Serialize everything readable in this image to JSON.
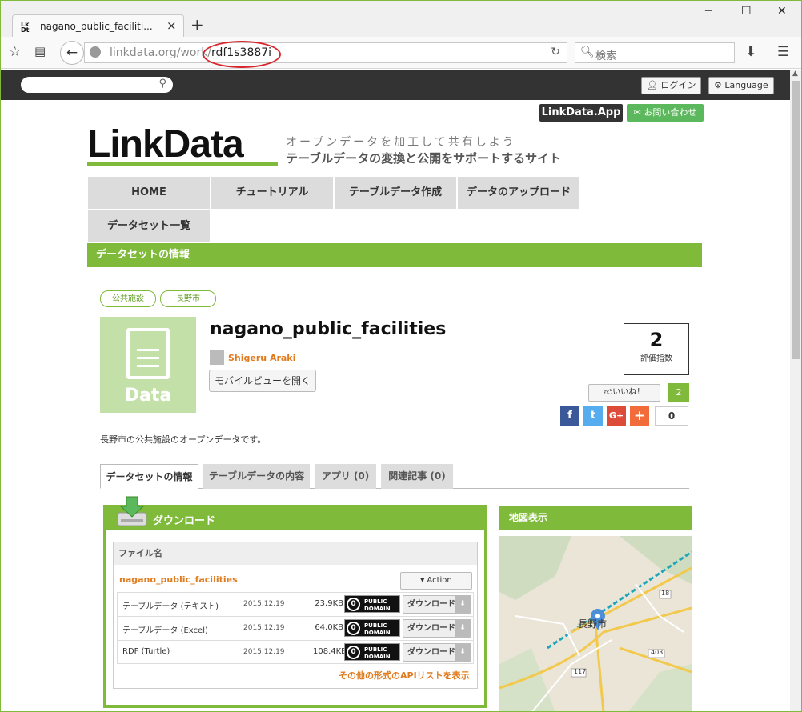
{
  "browser": {
    "tab_title": "nagano_public_faciliti...",
    "tab_favicon": "LinkData",
    "url_host": "linkdata.org/work/",
    "url_path": "rdf1s3887i",
    "search_placeholder": "検索",
    "accent_color": "#7fba3a"
  },
  "topbar": {
    "login_label": "ログイン",
    "language_label": "Language"
  },
  "header": {
    "linkdata_app": "LinkData.App",
    "contact_label": "お問い合わせ",
    "logo_text": "LinkData",
    "tagline1": "オープンデータを加工して共有しよう",
    "tagline2": "テーブルデータの変換と公開をサポートするサイト"
  },
  "menu": {
    "items": [
      "HOME",
      "チュートリアル",
      "テーブルデータ作成",
      "データのアップロード",
      "データセット一覧"
    ]
  },
  "section_title": "データセットの情報",
  "dataset": {
    "tags": [
      "公共施設",
      "長野市"
    ],
    "thumb_label": "Data",
    "title": "nagano_public_facilities",
    "author": "Shigeru Araki",
    "mobile_view_label": "モバイルビューを開く",
    "score": "2",
    "score_label": "評価指数",
    "like_label": "いいね！",
    "like_count": "2",
    "share_count": "0",
    "description": "長野市の公共施設のオープンデータです。"
  },
  "tabs": [
    "データセットの情報",
    "テーブルデータの内容",
    "アプリ (0)",
    "関連記事 (0)"
  ],
  "download": {
    "heading": "ダウンロード",
    "file_header": "ファイル名",
    "file_name": "nagano_public_facilities",
    "action_label": "▾ Action",
    "rows": [
      {
        "name": "テーブルデータ (テキスト)",
        "date": "2015.12.19",
        "size": "23.9KB"
      },
      {
        "name": "テーブルデータ (Excel)",
        "date": "2015.12.19",
        "size": "64.0KB"
      },
      {
        "name": "RDF (Turtle)",
        "date": "2015.12.19",
        "size": "108.4KB"
      }
    ],
    "license_line1": "PUBLIC",
    "license_line2": "DOMAIN",
    "download_button": "ダウンロード",
    "api_link": "その他の形式のAPIリストを表示"
  },
  "map": {
    "heading": "地図表示",
    "place_label": "長野市",
    "route_labels": [
      "18",
      "117",
      "403"
    ]
  }
}
